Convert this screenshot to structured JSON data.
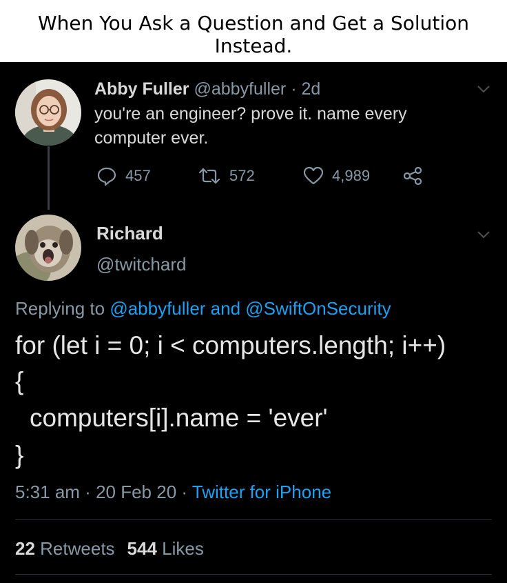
{
  "caption": {
    "line1": "When You Ask a Question and Get a Solution",
    "line2": "Instead."
  },
  "tweet1": {
    "author_name": "Abby Fuller",
    "author_handle": "@abbyfuller",
    "separator": " · ",
    "age": "2d",
    "text_line1": "you're an engineer? prove it. name every",
    "text_line2": "computer ever.",
    "replies": "457",
    "retweets": "572",
    "likes": "4,989"
  },
  "tweet2": {
    "author_name": "Richard",
    "author_handle": "@twitchard",
    "replying_prefix": "Replying to ",
    "replying_user1": "@abbyfuller",
    "replying_and": " and ",
    "replying_user2": "@SwiftOnSecurity",
    "code_line1": "for (let i = 0; i < computers.length; i++)",
    "code_line2": "{",
    "code_line3": "computers[i].name = 'ever'",
    "code_line4": "}",
    "time": "5:31 am",
    "date": "20 Feb 20",
    "meta_separator": " · ",
    "source": "Twitter for iPhone",
    "retweet_count": "22",
    "retweet_label": "Retweets",
    "like_count": "544",
    "like_label": "Likes"
  },
  "colors": {
    "background": "#000000",
    "text": "#d9d9d9",
    "muted": "#8899a6",
    "link": "#1da1f2"
  },
  "icons": {
    "reply": "reply-bubble-icon",
    "retweet": "retweet-icon",
    "like": "heart-icon",
    "share": "share-icon",
    "menu": "chevron-down-icon"
  }
}
